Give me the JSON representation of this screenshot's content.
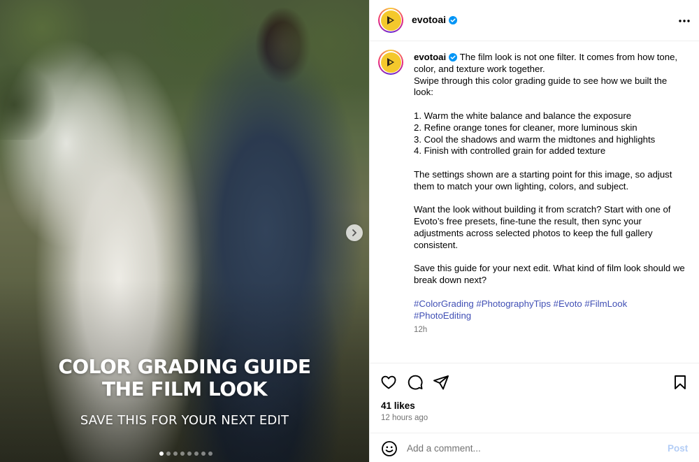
{
  "media": {
    "overlay_title_line1": "COLOR GRADING GUIDE",
    "overlay_title_line2": "THE FILM LOOK",
    "overlay_subtitle": "SAVE THIS FOR YOUR NEXT EDIT",
    "carousel": {
      "total_slides": 8,
      "current_slide": 1
    },
    "next_icon": "chevron-right-icon"
  },
  "header": {
    "username": "evotoai",
    "verified": true,
    "more_icon": "more-horizontal-icon"
  },
  "caption": {
    "username": "evotoai",
    "text": " The film look is not one filter. It comes from how tone, color, and texture work together.\nSwipe through this color grading guide to see how we built the look:\n\n1. Warm the white balance and balance the exposure\n2. Refine orange tones for cleaner, more luminous skin\n3. Cool the shadows and warm the midtones and highlights\n4. Finish with controlled grain for added texture\n\nThe settings shown are a starting point for this image, so adjust them to match your own lighting, colors, and subject.\n\nWant the look without building it from scratch? Start with one of Evoto’s free presets, fine-tune the result, then sync your adjustments across selected photos to keep the full gallery consistent.\n\nSave this guide for your next edit. What kind of film look should we break down next?",
    "hashtags": "#ColorGrading #PhotographyTips #Evoto #FilmLook\n#PhotoEditing",
    "time": "12h"
  },
  "actions": {
    "icons": [
      "heart-icon",
      "comment-icon",
      "share-icon",
      "bookmark-icon"
    ],
    "likes": "41 likes",
    "posted": "12 hours ago"
  },
  "comment": {
    "placeholder": "Add a comment...",
    "post_label": "Post",
    "emoji_icon": "smiley-icon"
  },
  "colors": {
    "accent_link": "#4150b5",
    "verified_blue": "#0095f6",
    "post_disabled": "#b3cdf6",
    "muted_text": "#737373"
  }
}
